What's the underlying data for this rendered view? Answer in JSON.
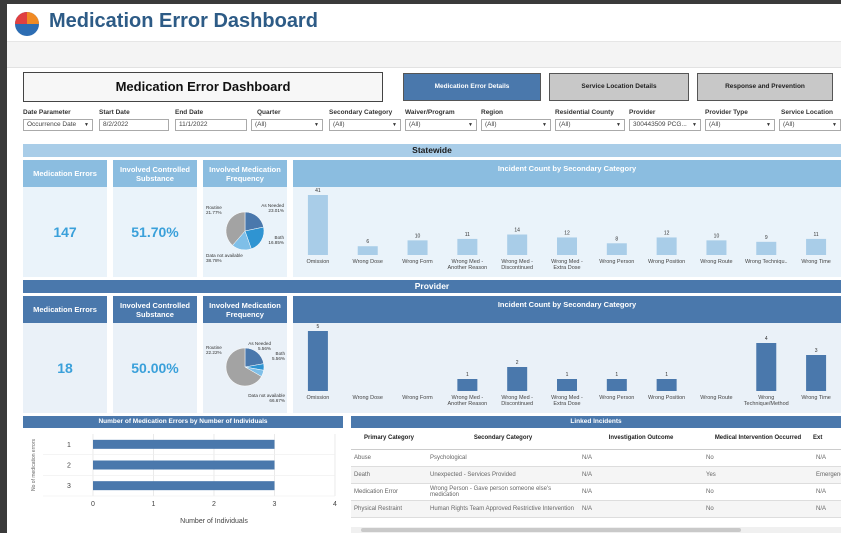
{
  "app": {
    "title": "Medication Error Dashboard"
  },
  "header": {
    "title": "Medication Error Dashboard",
    "tabs": [
      {
        "label": "Medication Error Details",
        "active": true
      },
      {
        "label": "Service Location Details",
        "active": false
      },
      {
        "label": "Response and Prevention",
        "active": false
      }
    ]
  },
  "filters": [
    {
      "label": "Date Parameter",
      "value": "Occurrence Date"
    },
    {
      "label": "Start Date",
      "value": "8/2/2022"
    },
    {
      "label": "End Date",
      "value": "11/1/2022"
    },
    {
      "label": "Quarter",
      "value": "(All)"
    },
    {
      "label": "Secondary Category",
      "value": "(All)"
    },
    {
      "label": "Waiver/Program",
      "value": "(All)"
    },
    {
      "label": "Region",
      "value": "(All)"
    },
    {
      "label": "Residential County",
      "value": "(All)"
    },
    {
      "label": "Provider",
      "value": "300443509 PCG..."
    },
    {
      "label": "Provider Type",
      "value": "(All)"
    },
    {
      "label": "Service Location",
      "value": "(All)"
    }
  ],
  "statewide": {
    "band": "Statewide",
    "kpis": [
      {
        "label": "Medication Errors",
        "value": "147"
      },
      {
        "label": "Involved Controlled Substance",
        "value": "51.70%"
      }
    ],
    "freq_title": "Involved Medication Frequency",
    "chart_title": "Incident Count by Secondary Category"
  },
  "provider": {
    "band": "Provider",
    "kpis": [
      {
        "label": "Medication Errors",
        "value": "18"
      },
      {
        "label": "Involved Controlled Substance",
        "value": "50.00%"
      }
    ],
    "freq_title": "Involved Medication Frequency",
    "chart_title": "Incident Count by Secondary Category"
  },
  "bottom_chart": {
    "title": "Number of Medication Errors by Number of Individuals",
    "ylabel": "No of medication errors",
    "xlabel": "Number of Individuals"
  },
  "linked": {
    "title": "Linked Incidents",
    "columns": [
      "Primary Category",
      "Secondary Category",
      "Investigation Outcome",
      "Medical Intervention Occurred",
      "Ext"
    ],
    "rows": [
      [
        "Abuse",
        "Psychological",
        "N/A",
        "No",
        "N/A"
      ],
      [
        "Death",
        "Unexpected - Services Provided",
        "N/A",
        "Yes",
        "Emergenc"
      ],
      [
        "Medication Error",
        "Wrong Person - Gave person someone else's medication",
        "N/A",
        "No",
        "N/A"
      ],
      [
        "Physical Restraint",
        "Human Rights Team Approved Restrictive Intervention",
        "N/A",
        "No",
        "N/A"
      ]
    ]
  },
  "chart_data": [
    {
      "type": "bar",
      "title": "Incident Count by Secondary Category",
      "categories": [
        "Omission",
        "Wrong Dose",
        "Wrong Form",
        "Wrong Med - Another Reason",
        "Wrong Med - Discontinued",
        "Wrong Med - Extra Dose",
        "Wrong Person",
        "Wrong Position",
        "Wrong Route",
        "Wrong Techniqu..",
        "Wrong Time"
      ],
      "values": [
        41,
        6,
        10,
        11,
        14,
        12,
        8,
        12,
        10,
        9,
        11
      ],
      "color": "#a9cde8"
    },
    {
      "type": "pie",
      "title": "Involved Medication Frequency",
      "slices": [
        {
          "label": "Routine",
          "value": 21.77,
          "text": "21.77%",
          "color": "#4a78ac"
        },
        {
          "label": "As Needed",
          "value": 23.01,
          "text": "23.01%",
          "color": "#2f94d2"
        },
        {
          "label": "Both",
          "value": 16.85,
          "text": "16.85%",
          "color": "#7fbfe8"
        },
        {
          "label": "Data not available",
          "value": 38.78,
          "text": "38.78%",
          "color": "#a3a3a3"
        }
      ]
    },
    {
      "type": "bar",
      "title": "Incident Count by Secondary Category",
      "categories": [
        "Omission",
        "Wrong Dose",
        "Wrong Form",
        "Wrong Med - Another Reason",
        "Wrong Med - Discontinued",
        "Wrong Med - Extra Dose",
        "Wrong Person",
        "Wrong Position",
        "Wrong Route",
        "Wrong Technique/Method",
        "Wrong Time"
      ],
      "values": [
        5,
        0,
        0,
        1,
        2,
        1,
        1,
        1,
        0,
        4,
        3
      ],
      "color": "#4a78ac"
    },
    {
      "type": "pie",
      "title": "Involved Medication Frequency",
      "slices": [
        {
          "label": "Routine",
          "value": 22.22,
          "text": "22.22%",
          "color": "#4a78ac"
        },
        {
          "label": "As Needed",
          "value": 5.56,
          "text": "5.56%",
          "color": "#2f94d2"
        },
        {
          "label": "Both",
          "value": 5.56,
          "text": "5.56%",
          "color": "#7fbfe8"
        },
        {
          "label": "Data not available",
          "value": 66.67,
          "text": "66.67%",
          "color": "#a3a3a3"
        }
      ]
    },
    {
      "type": "bar",
      "orientation": "horizontal",
      "title": "Number of Medication Errors by Number of Individuals",
      "categories": [
        "1",
        "2",
        "3"
      ],
      "values": [
        3,
        3,
        3
      ],
      "xlim": [
        0,
        4
      ],
      "xticks": [
        "0",
        "1",
        "2",
        "3",
        "4"
      ],
      "xlabel": "Number of Individuals",
      "ylabel": "No of medication errors",
      "color": "#4a78ac"
    }
  ]
}
